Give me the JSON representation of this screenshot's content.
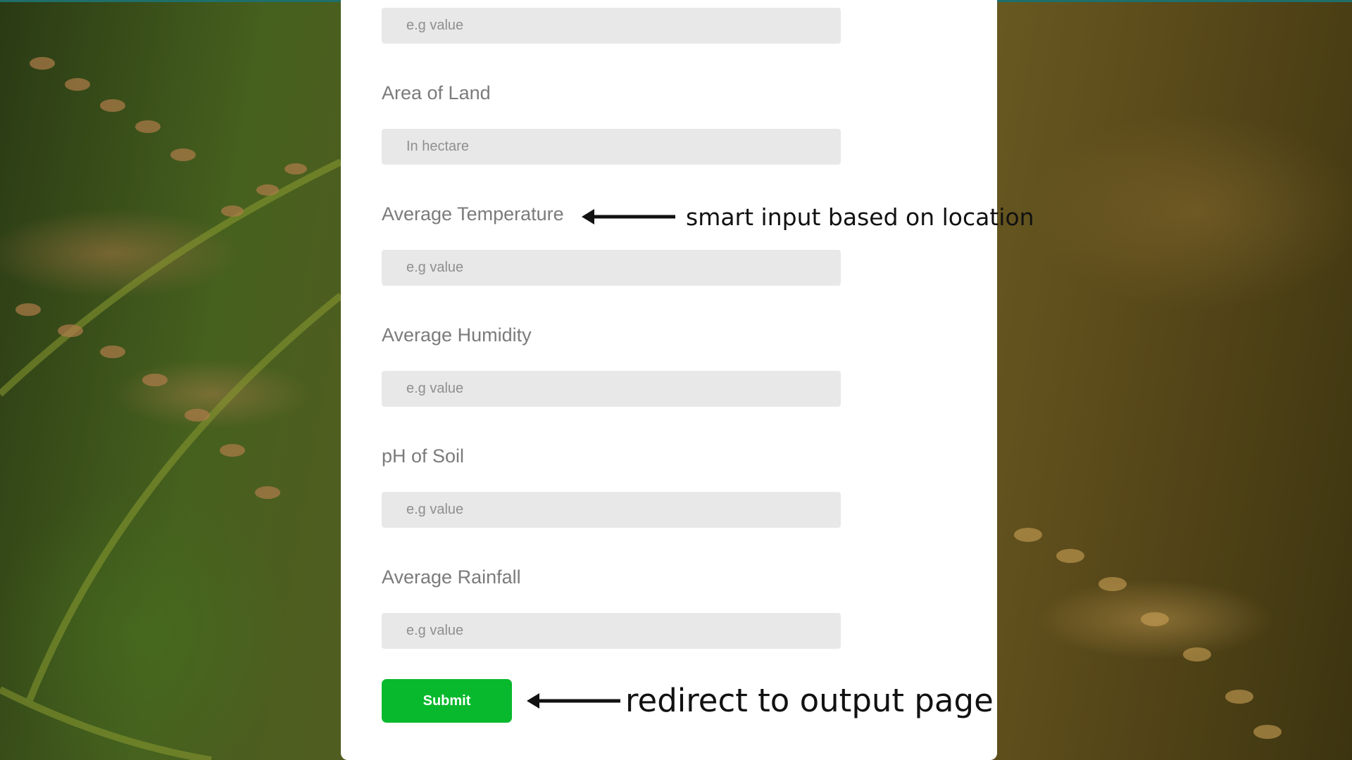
{
  "form": {
    "fields": [
      {
        "label": "",
        "placeholder": "e.g value"
      },
      {
        "label": "Area of Land",
        "placeholder": "In hectare"
      },
      {
        "label": "Average Temperature",
        "placeholder": "e.g value"
      },
      {
        "label": "Average Humidity",
        "placeholder": "e.g value"
      },
      {
        "label": "pH of Soil",
        "placeholder": "e.g value"
      },
      {
        "label": "Average Rainfall",
        "placeholder": "e.g value"
      }
    ],
    "submit_label": "Submit"
  },
  "annotations": {
    "temperature_note": "smart input based on location",
    "submit_note": "redirect to output page"
  },
  "colors": {
    "submit_bg": "#08b92d",
    "input_bg": "#e8e8e8",
    "label_text": "#7b7b7b",
    "top_bar": "#1f6f6a"
  }
}
